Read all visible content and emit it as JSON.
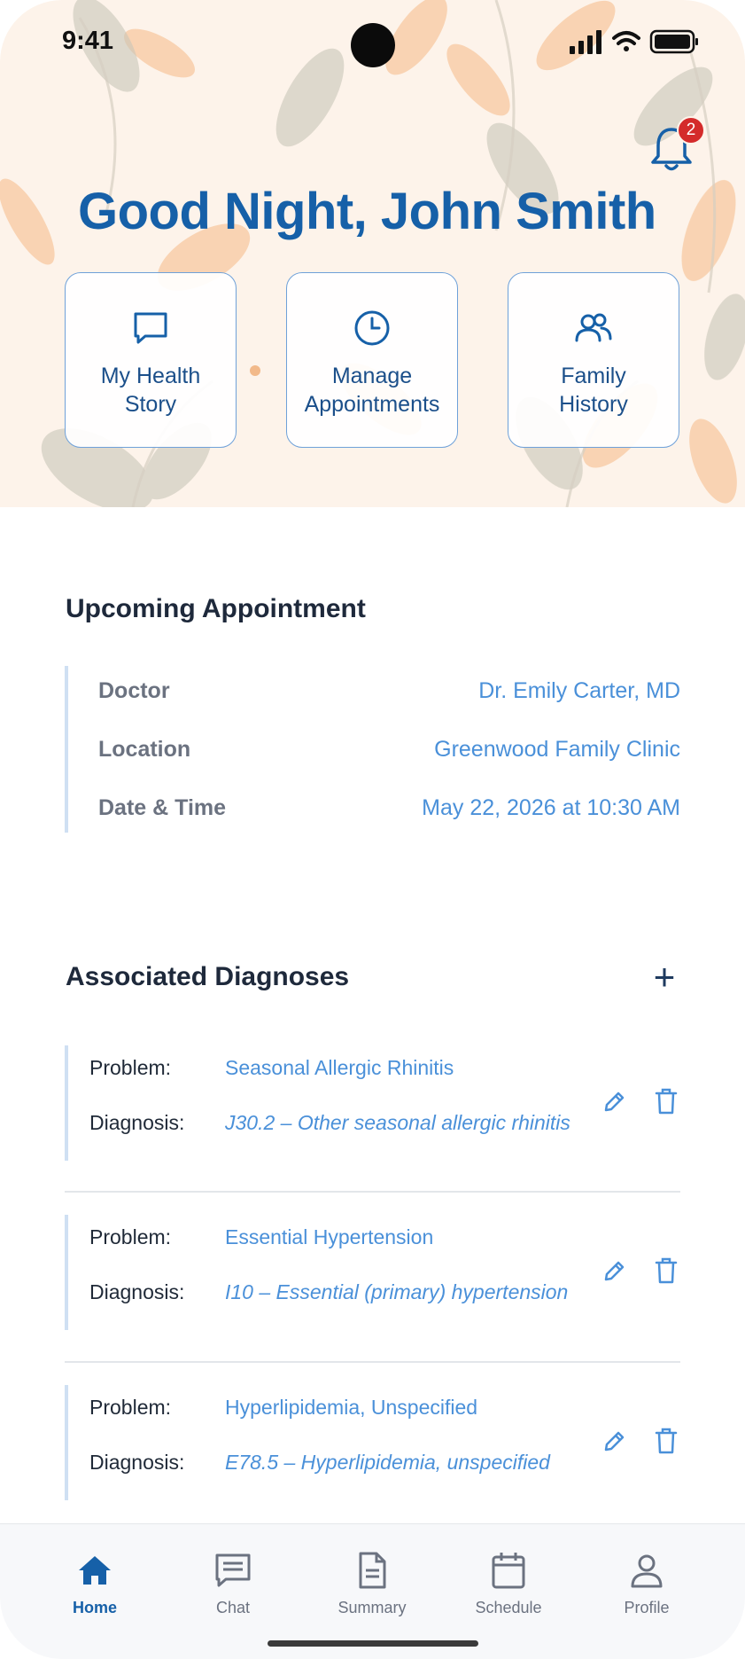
{
  "status_bar": {
    "time": "9:41"
  },
  "header": {
    "greeting": "Good Night, John Smith",
    "notification_count": "2"
  },
  "quick_actions": [
    {
      "label_line1": "My Health",
      "label_line2": "Story",
      "icon": "chat-bubble-icon"
    },
    {
      "label_line1": "Manage",
      "label_line2": "Appointments",
      "icon": "clock-icon"
    },
    {
      "label_line1": "Family",
      "label_line2": "History",
      "icon": "users-icon"
    }
  ],
  "upcoming": {
    "title": "Upcoming Appointment",
    "rows": [
      {
        "label": "Doctor",
        "value": "Dr. Emily Carter, MD"
      },
      {
        "label": "Location",
        "value": "Greenwood Family Clinic"
      },
      {
        "label": "Date & Time",
        "value": "May 22, 2026 at 10:30 AM"
      }
    ]
  },
  "diagnoses": {
    "title": "Associated Diagnoses",
    "add_label": "+",
    "problem_label": "Problem:",
    "diagnosis_label": "Diagnosis:",
    "items": [
      {
        "problem": "Seasonal Allergic Rhinitis",
        "diagnosis": "J30.2 – Other seasonal allergic rhinitis"
      },
      {
        "problem": "Essential Hypertension",
        "diagnosis": "I10 – Essential (primary) hypertension"
      },
      {
        "problem": "Hyperlipidemia, Unspecified",
        "diagnosis": "E78.5 – Hyperlipidemia, unspecified"
      }
    ]
  },
  "nav": [
    {
      "label": "Home",
      "icon": "home-icon",
      "active": true
    },
    {
      "label": "Chat",
      "icon": "chat-icon"
    },
    {
      "label": "Summary",
      "icon": "document-icon"
    },
    {
      "label": "Schedule",
      "icon": "calendar-icon"
    },
    {
      "label": "Profile",
      "icon": "person-icon"
    }
  ],
  "colors": {
    "primary": "#1660a8",
    "accent_link": "#4a90d9",
    "badge": "#d42b2b",
    "hero_bg": "#fdf3ea"
  }
}
